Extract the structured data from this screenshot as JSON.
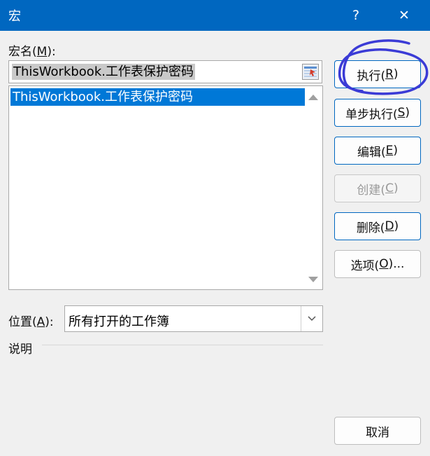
{
  "window": {
    "title": "宏",
    "help": "?",
    "close": "✕"
  },
  "macro_name": {
    "label_pre": "宏名(",
    "label_key": "M",
    "label_post": "):",
    "value": "ThisWorkbook.工作表保护密码"
  },
  "macro_list": {
    "items": [
      "ThisWorkbook.工作表保护密码"
    ]
  },
  "location": {
    "label_pre": "位置(",
    "label_key": "A",
    "label_post": "):",
    "value": "所有打开的工作簿"
  },
  "description": {
    "label": "说明"
  },
  "buttons": {
    "run": {
      "pre": "执行(",
      "key": "R",
      "post": ")"
    },
    "step": {
      "pre": "单步执行(",
      "key": "S",
      "post": ")"
    },
    "edit": {
      "pre": "编辑(",
      "key": "E",
      "post": ")"
    },
    "create": {
      "pre": "创建(",
      "key": "C",
      "post": ")"
    },
    "delete": {
      "pre": "删除(",
      "key": "D",
      "post": ")"
    },
    "options": {
      "pre": "选项(",
      "key": "O",
      "post": ")..."
    },
    "cancel": "取消"
  },
  "colors": {
    "title_bar": "#0067c0",
    "selection": "#0078d7",
    "annotation": "#3b3bd6"
  }
}
